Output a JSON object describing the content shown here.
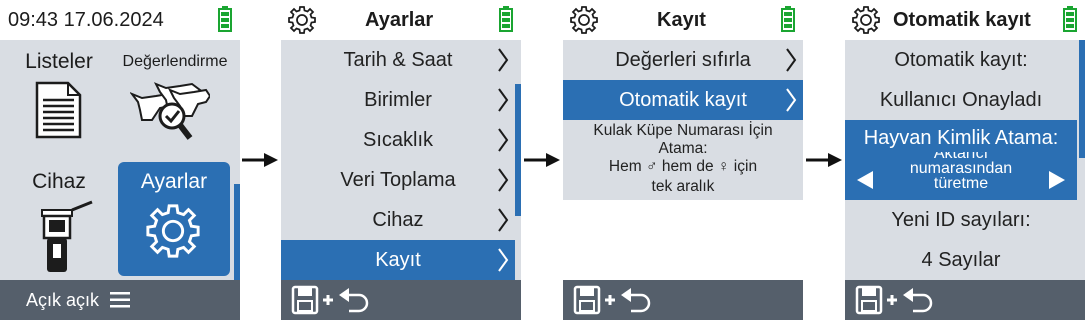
{
  "screen1": {
    "status_time": "09:43 17.06.2024",
    "tiles": [
      {
        "label": "Listeler",
        "icon": "document-list-icon"
      },
      {
        "label": "Değerlendirme",
        "icon": "cows-search-icon"
      },
      {
        "label": "Cihaz",
        "icon": "handheld-reader-icon"
      },
      {
        "label": "Ayarlar",
        "icon": "gear-icon"
      }
    ],
    "footer_label": "Açık açık",
    "footer_icon": "menu-icon"
  },
  "screen2": {
    "title": "Ayarlar",
    "items": [
      "Tarih & Saat",
      "Birimler",
      "Sıcaklık",
      "Veri Toplama",
      "Cihaz",
      "Kayıt"
    ],
    "selected": "Kayıt"
  },
  "screen3": {
    "title": "Kayıt",
    "items": [
      "Değerleri sıfırla",
      "Otomatik kayıt"
    ],
    "selected": "Otomatik kayıt",
    "info_lines": [
      "Kulak Küpe Numarası İçin",
      "Atama:",
      "Hem ♂ hem de ♀ için",
      "tek aralık"
    ]
  },
  "screen4": {
    "title": "Otomatik kayıt",
    "rows": [
      "Otomatik kayıt:",
      "Kullanıcı Onayladı",
      "Hayvan Kimlik Atama:"
    ],
    "selector_lines": [
      "Aktarıcı",
      "numarasından",
      "türetme"
    ],
    "rows_after": [
      "Yeni ID sayıları:",
      "4 Sayılar"
    ]
  },
  "colors": {
    "accent_blue": "#2b6fb3",
    "panel_gray": "#d9dde3",
    "footer_gray": "#555f6b",
    "battery_green": "#1aa531"
  }
}
